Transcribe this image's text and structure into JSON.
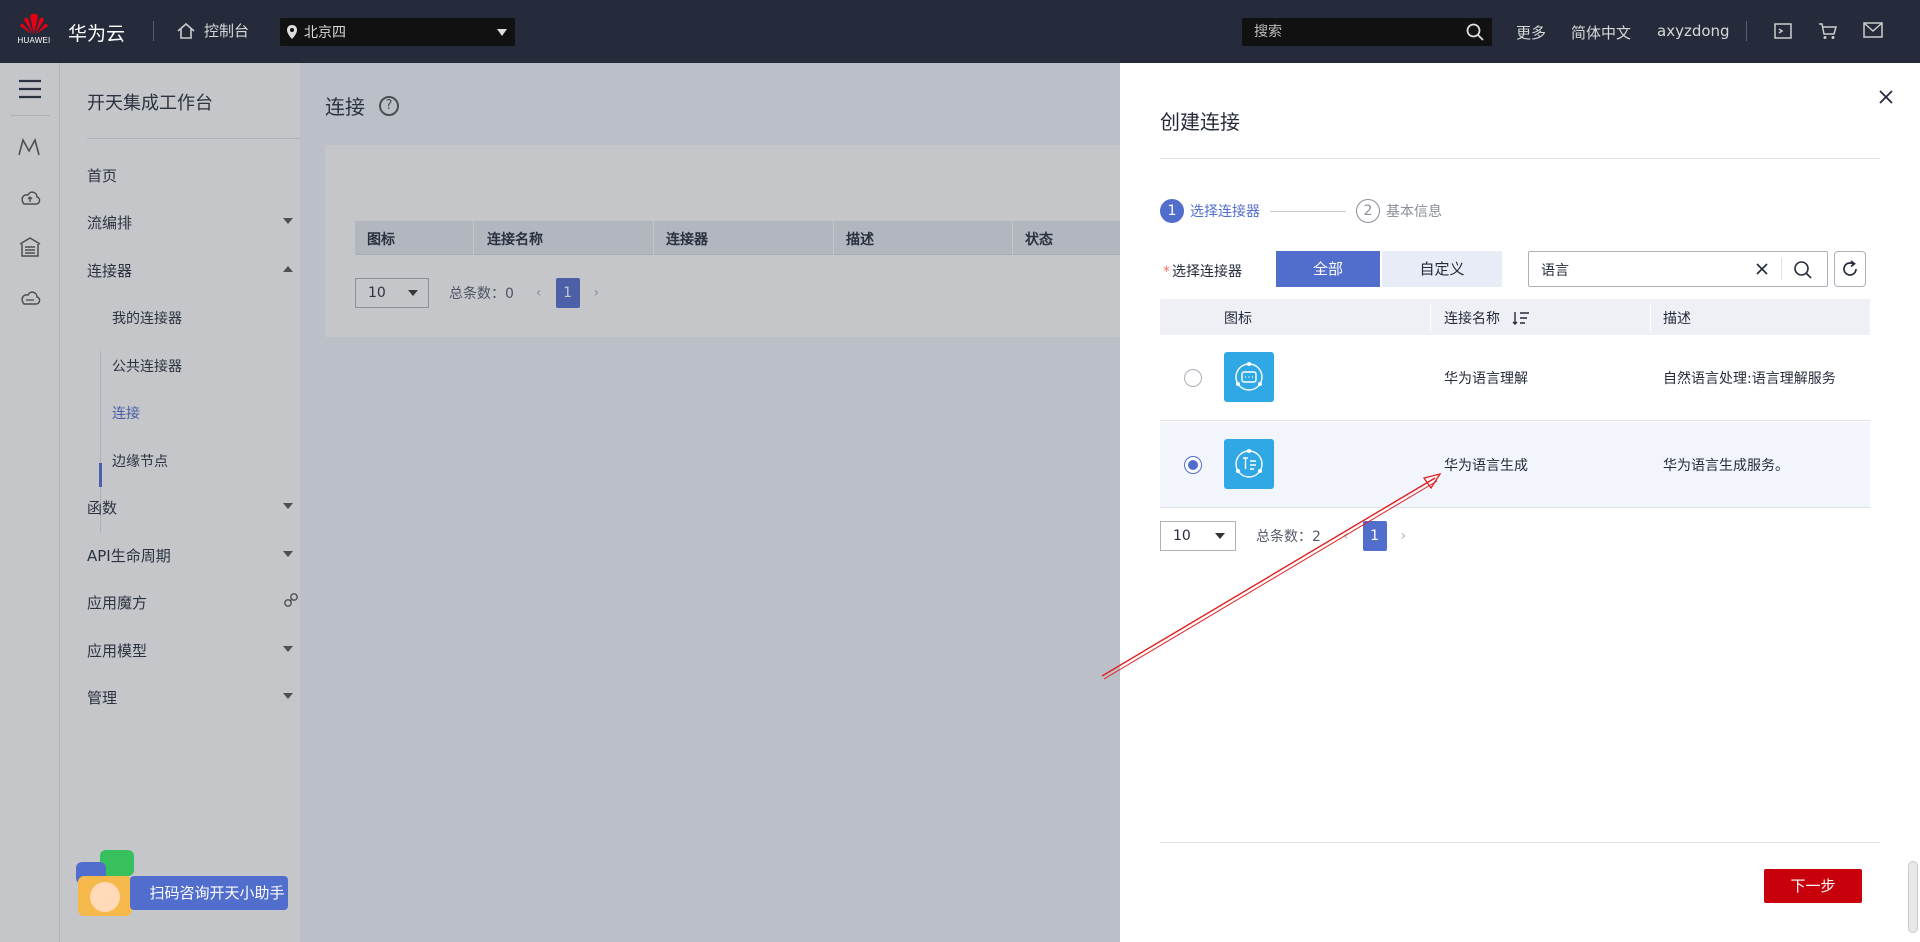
{
  "topbar": {
    "logo_text": "HUAWEI",
    "brand": "华为云",
    "console": "控制台",
    "region": "北京四",
    "search_placeholder": "搜索",
    "more": "更多",
    "language": "简体中文",
    "user": "axyzdong"
  },
  "nav": {
    "title": "开天集成工作台",
    "items": [
      {
        "label": "首页"
      },
      {
        "label": "流编排"
      },
      {
        "label": "连接器"
      },
      {
        "label": "函数"
      },
      {
        "label": "API生命周期"
      },
      {
        "label": "应用魔方"
      },
      {
        "label": "应用模型"
      },
      {
        "label": "管理"
      }
    ],
    "sub_items": [
      {
        "label": "我的连接器"
      },
      {
        "label": "公共连接器"
      },
      {
        "label": "连接"
      },
      {
        "label": "边缘节点"
      }
    ],
    "helper": "扫码咨询开天小助手"
  },
  "main": {
    "title": "连接",
    "help_glyph": "?",
    "columns": [
      "图标",
      "连接名称",
      "连接器",
      "描述",
      "状态"
    ],
    "page_size": "10",
    "total": "总条数：0",
    "page": "1",
    "prev": "‹",
    "next": "›"
  },
  "drawer": {
    "title": "创建连接",
    "steps": [
      {
        "num": "1",
        "label": "选择连接器"
      },
      {
        "num": "2",
        "label": "基本信息"
      }
    ],
    "select_label": "选择连接器",
    "required_mark": "*",
    "tabs": {
      "all": "全部",
      "custom": "自定义"
    },
    "search_value": "语言",
    "columns": {
      "icon": "图标",
      "name": "连接名称",
      "desc": "描述"
    },
    "rows": [
      {
        "name": "华为语言理解",
        "desc": "自然语言处理:语言理解服务",
        "selected": false
      },
      {
        "name": "华为语言生成",
        "desc": "华为语言生成服务。",
        "selected": true
      }
    ],
    "page_size": "10",
    "total": "总条数：2",
    "page": "1",
    "prev": "‹",
    "next": "›",
    "next_button": "下一步"
  },
  "colors": {
    "topbar_bg": "#252b3a",
    "accent": "#526ecc",
    "primary_button": "#c7000b",
    "connector_icon": "#2fa8e5",
    "annotation_arrow": "#e02020"
  }
}
